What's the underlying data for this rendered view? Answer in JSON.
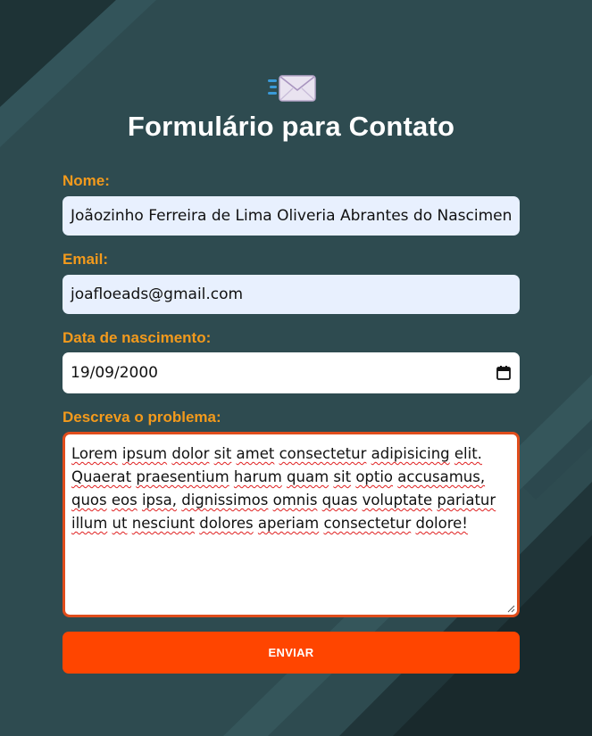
{
  "form": {
    "title": "Formulário para Contato",
    "icon": "envelope-with-speed-lines-icon",
    "name_label": "Nome:",
    "name_value": "Joãozinho Ferreira de Lima Oliveria Abrantes do Nascimen",
    "email_label": "Email:",
    "email_value": "joafloeads@gmail.com",
    "date_label": "Data de nascimento:",
    "date_value": "19/09/2000",
    "problem_label": "Descreva o problema:",
    "problem_words": [
      "Lorem",
      "ipsum",
      "dolor",
      "sit",
      "amet",
      "consectetur",
      "adipisicing",
      "elit.",
      "Quaerat",
      "praesentium",
      "harum",
      "quam",
      "sit",
      "optio",
      "accusamus,",
      "quos",
      "eos",
      "ipsa,",
      "dignissimos",
      "omnis",
      "quas",
      "voluptate",
      "pariatur",
      "illum",
      "ut",
      "nesciunt",
      "dolores",
      "aperiam",
      "consectetur",
      "dolore!"
    ],
    "submit_label": "ENVIAR"
  },
  "colors": {
    "background": "#2d4a4f",
    "label": "#f39a1c",
    "button": "#ff4500",
    "textarea_border": "#e04d1c",
    "autofill_field": "#e8f0fe"
  }
}
